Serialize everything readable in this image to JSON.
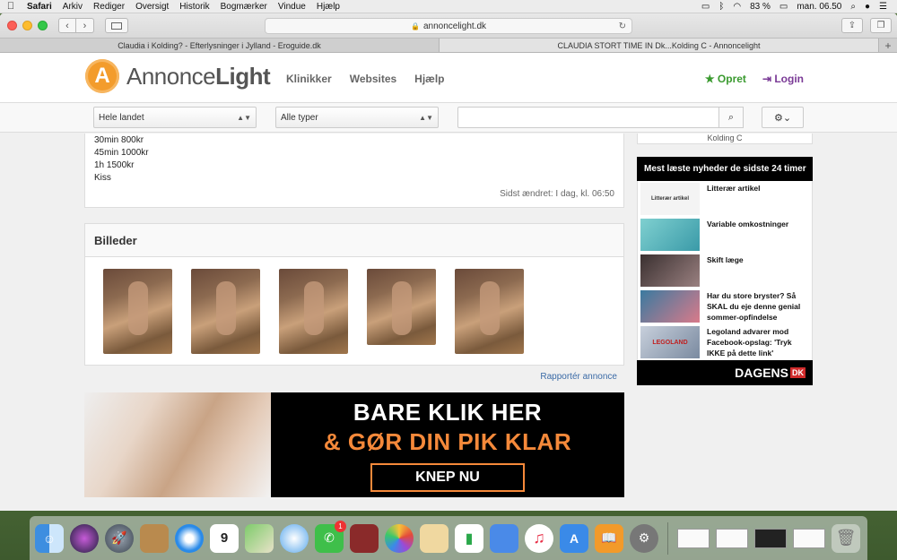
{
  "menubar": {
    "apple": "",
    "app": "Safari",
    "items": [
      "Arkiv",
      "Rediger",
      "Oversigt",
      "Historik",
      "Bogmærker",
      "Vindue",
      "Hjælp"
    ],
    "battery": "83 %",
    "clock": "man. 06.50"
  },
  "browser": {
    "url": "annoncelight.dk",
    "tabs": [
      {
        "label": "Claudia i Kolding? - Efterlysninger i Jylland - Eroguide.dk"
      },
      {
        "label": "CLAUDIA STORT TIME IN Dk...Kolding C - Annoncelight"
      }
    ],
    "new_tab": "+"
  },
  "site": {
    "logo_letter": "A",
    "logo_part1": "Annonce",
    "logo_part2": "Light",
    "nav": [
      "Klinikker",
      "Websites",
      "Hjælp"
    ],
    "opret": "Opret",
    "login": "Login"
  },
  "filters": {
    "region": "Hele landet",
    "type": "Alle typer",
    "search_value": ""
  },
  "ad": {
    "lines": [
      "30min 800kr",
      "45min 1000kr",
      "1h 1500kr",
      "Kiss"
    ],
    "changed": "Sidst ændret: I dag, kl. 06:50",
    "images_title": "Billeder",
    "report": "Rapportér annonce"
  },
  "banner": {
    "line1": "BARE KLIK HER",
    "line2": "& GØR DIN PIK KLAR",
    "button": "KNEP NU"
  },
  "sidebar": {
    "location": "Kolding C",
    "news_title": "Mest læste nyheder de sidste 24 timer",
    "news": [
      {
        "title": "Litterær artikel",
        "thumb_text": "Litterær artikel",
        "color": "#f4f4f4"
      },
      {
        "title": "Variable omkostninger",
        "thumb_text": "",
        "color": "#4fb0b5"
      },
      {
        "title": "Skift læge",
        "thumb_text": "",
        "color": "#6a5a5a"
      },
      {
        "title": "Har du store bryster? Så SKAL du eje denne genial sommer-opfindelse",
        "thumb_text": "",
        "color": "#c96a7a"
      },
      {
        "title": "Legoland advarer mod Facebook-opslag: 'Tryk IKKE på dette link'",
        "thumb_text": "LEGOLAND",
        "color": "#8a9ab0"
      }
    ],
    "brand": "DAGENS",
    "brand_suffix": "DK"
  },
  "dock": {
    "calendar_day": "9",
    "facetime_badge": "1"
  }
}
